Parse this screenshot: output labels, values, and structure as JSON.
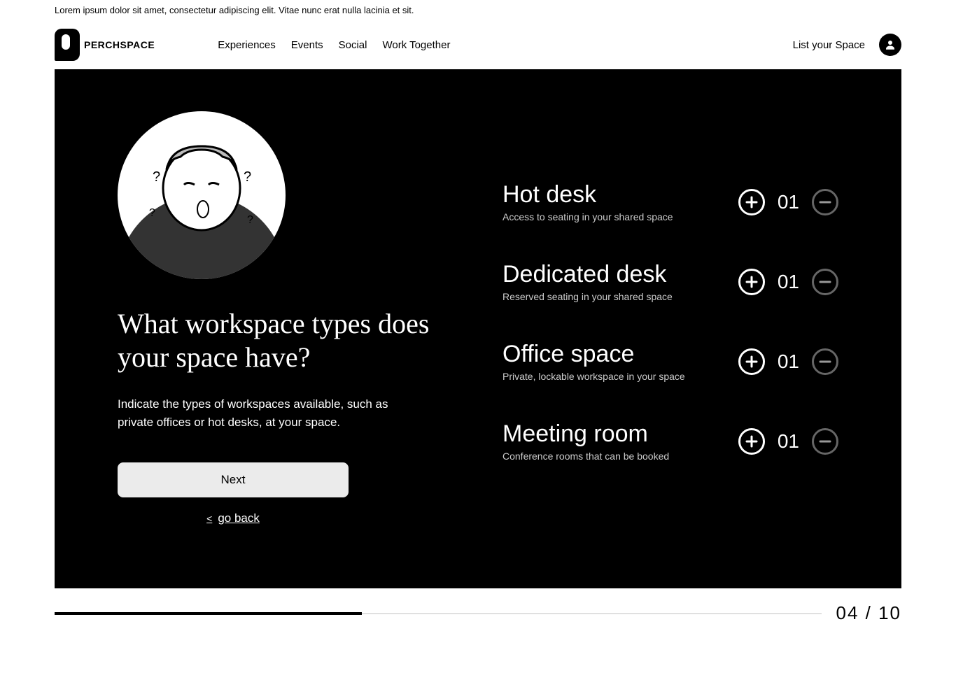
{
  "banner": {
    "text": "Lorem ipsum dolor sit amet, consectetur adipiscing elit. Vitae nunc erat nulla lacinia et sit."
  },
  "header": {
    "logo_text": "PERCHSPACE",
    "nav": [
      "Experiences",
      "Events",
      "Social",
      "Work Together"
    ],
    "list_space": "List your Space"
  },
  "main": {
    "heading": "What workspace types does your space have?",
    "subtext": "Indicate the types of workspaces available, such as private offices or hot desks, at your space.",
    "next_label": "Next",
    "go_back_label": "go back"
  },
  "workspaces": [
    {
      "title": "Hot desk",
      "desc": "Access to seating in your shared space",
      "value": "01"
    },
    {
      "title": "Dedicated desk",
      "desc": "Reserved seating in your shared space",
      "value": "01"
    },
    {
      "title": "Office space",
      "desc": "Private, lockable workspace in your space",
      "value": "01"
    },
    {
      "title": "Meeting room",
      "desc": "Conference rooms that can be booked",
      "value": "01"
    }
  ],
  "footer": {
    "progress_percent": 40,
    "page_indicator": "04 / 10"
  }
}
